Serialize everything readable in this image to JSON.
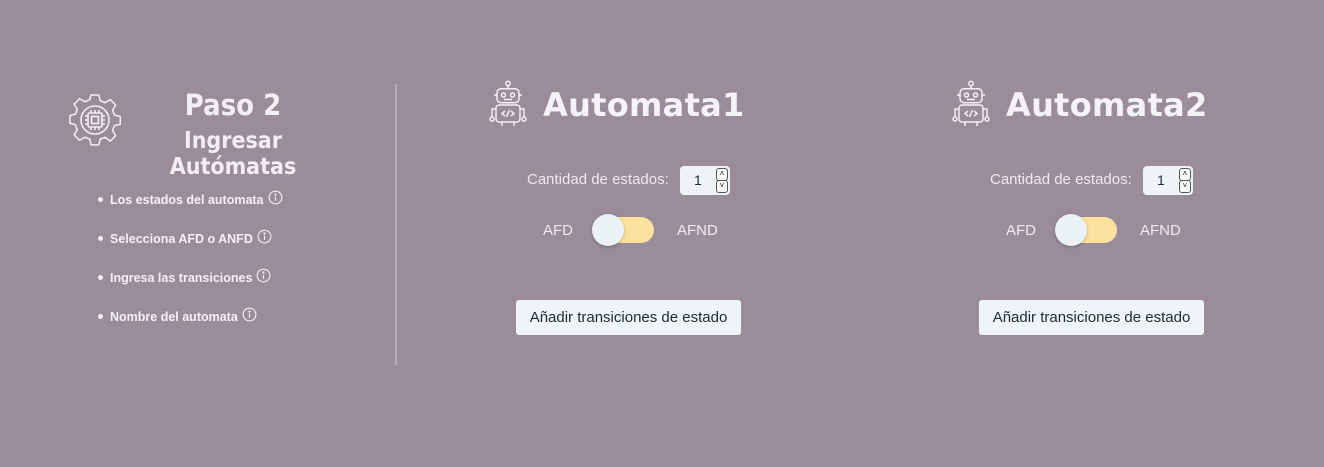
{
  "step": {
    "title": "Paso 2",
    "subtitle": "Ingresar Autómatas",
    "icon": "gear-chip-icon",
    "items": [
      {
        "label": "Los estados del automata",
        "icon": "info-icon"
      },
      {
        "label": "Selecciona AFD o ANFD",
        "icon": "info-icon"
      },
      {
        "label": "Ingresa las transiciones",
        "icon": "info-icon"
      },
      {
        "label": "Nombre del automata",
        "icon": "info-icon"
      }
    ]
  },
  "automatas": [
    {
      "name": "Automata1",
      "icon": "robot-icon",
      "states_label": "Cantidad de estados:",
      "states_value": "1",
      "afd_label": "AFD",
      "afnd_label": "AFND",
      "toggle_on": false,
      "add_button": "Añadir transiciones de estado"
    },
    {
      "name": "Automata2",
      "icon": "robot-icon",
      "states_label": "Cantidad de estados:",
      "states_value": "1",
      "afd_label": "AFD",
      "afnd_label": "AFND",
      "toggle_on": false,
      "add_button": "Añadir transiciones de estado"
    }
  ],
  "colors": {
    "background": "#9a8c99",
    "toggle_track": "#fbe29f",
    "button_bg": "#eef4f7",
    "text_light": "#f1f1f4"
  }
}
